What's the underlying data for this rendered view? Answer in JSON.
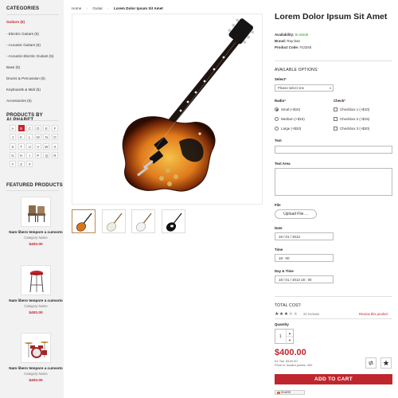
{
  "sidebar": {
    "categories_title": "CATEGORIES",
    "categories": [
      {
        "label": "Guitars (5)"
      },
      {
        "label": "- Electric Guitars (5)"
      },
      {
        "label": "- Acoustic Guitars (5)"
      },
      {
        "label": "- Acoustic-Electric Guitars (5)"
      },
      {
        "label": "Bass (5)"
      },
      {
        "label": "Drums & Percussion (5)"
      },
      {
        "label": "Keyboards & Midi (5)"
      },
      {
        "label": "Accessories (5)"
      }
    ],
    "alphabet_title": "PRODUCTS BY ALPHABET",
    "alphabet": [
      "A",
      "B",
      "C",
      "D",
      "E",
      "F",
      "J",
      "K",
      "L",
      "M",
      "N",
      "O",
      "S",
      "T",
      "U",
      "V",
      "W",
      "X",
      "G",
      "H",
      "I",
      "P",
      "Q",
      "R",
      "Y",
      "Z",
      "#"
    ],
    "featured_title": "FEATURED PRODUCTS",
    "featured": [
      {
        "name": "Nam libero tempore a cumsoto",
        "category": "Category Name",
        "price": "$400.00",
        "icon": "chair-icon"
      },
      {
        "name": "Nam libero tempore a cumsoto",
        "category": "Category Name",
        "price": "$400.00",
        "icon": "bar-stool-icon"
      },
      {
        "name": "Nam libero tempore a cumsoto",
        "category": "Category Name",
        "price": "$400.00",
        "icon": "drum-kit-icon"
      }
    ]
  },
  "breadcrumb": {
    "home": "Home",
    "category": "Guitar",
    "current": "Lorem Dolor Ipsum Sit Amet"
  },
  "product": {
    "title": "Lorem Dolor Ipsum Sit Amet",
    "availability_label": "Availability:",
    "availability_value": "In stock",
    "brand_label": "Brand:",
    "brand_value": "Ray-ban",
    "code_label": "Product Code:",
    "code_value": "#13345",
    "options_title": "AVAILABLE OPTIONS:",
    "select_label": "Select",
    "select_value": "Please select one",
    "radio_label": "Radio",
    "radios": [
      "Smal (+$10)",
      "Medium (+$15)",
      "Large (+$20)"
    ],
    "checkbox_label": "Check",
    "checkboxes": [
      "Checkbox 1 (+$10)",
      "Checkbox 2 (+$15)",
      "Checkbox 3 (+$20)"
    ],
    "text_label": "Text",
    "textarea_label": "Text Area",
    "file_label": "File",
    "upload_label": "Upload File ...",
    "date_label": "Date",
    "date_value": "18 / 01 / 2013",
    "time_label": "Time",
    "time_value": "18 : 00",
    "datetime_label": "Day & Time",
    "datetime_value": "18 / 01 / 2013  18 : 00",
    "total_title": "TOTAL COST:",
    "rating": 3,
    "rating_max": 5,
    "reviews": "20 reviews",
    "review_link": "Review this product",
    "quantity_label": "Quantity",
    "quantity_value": "1",
    "price": "$400.00",
    "ex_tax": "Ex Tax: $100.00",
    "reward": "Price in reward points: 400",
    "add_to_cart": "ADD TO CART",
    "share_label": "SHARE"
  },
  "colors": {
    "accent": "#c0262d",
    "in_stock": "#4caf50",
    "sidebar_bg": "#f2f2f2"
  }
}
